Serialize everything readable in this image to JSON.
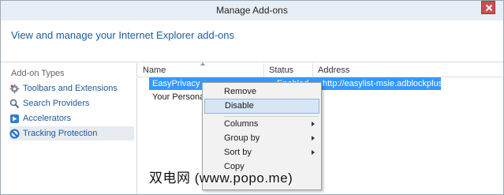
{
  "window": {
    "title": "Manage Add-ons"
  },
  "header": {
    "heading": "View and manage your Internet Explorer add-ons"
  },
  "sidebar": {
    "section_label": "Add-on Types",
    "items": [
      {
        "label": "Toolbars and Extensions",
        "icon": "gear-icon"
      },
      {
        "label": "Search Providers",
        "icon": "search-icon"
      },
      {
        "label": "Accelerators",
        "icon": "accelerator-icon"
      },
      {
        "label": "Tracking Protection",
        "icon": "no-entry-icon"
      }
    ]
  },
  "list": {
    "columns": [
      "Name",
      "Status",
      "Address"
    ],
    "rows": [
      {
        "name": "EasyPrivacy",
        "status": "Enabled",
        "address": "http://easylist-msie.adblockplus..."
      },
      {
        "name": "Your Personali..."
      }
    ]
  },
  "context_menu": {
    "items": [
      "Remove",
      "Disable",
      "Columns",
      "Group by",
      "Sort by",
      "Copy"
    ]
  },
  "watermark": "双电网 (www.popo.me)",
  "colors": {
    "accent": "#1e5a9e",
    "selection": "#3399ff",
    "menu_highlight": "#d7e6f5"
  }
}
